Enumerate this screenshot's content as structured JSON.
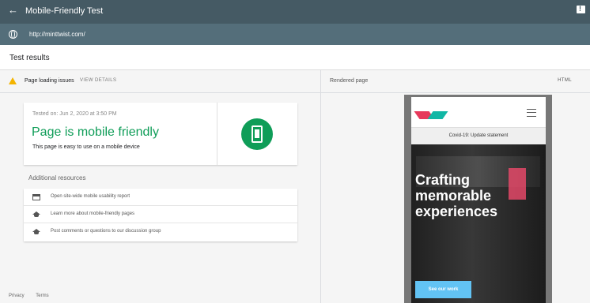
{
  "app": {
    "title": "Mobile-Friendly Test",
    "url": "http://minttwist.com/"
  },
  "results": {
    "title": "Test results",
    "issues_label": "Page loading issues",
    "details_label": "VIEW DETAILS",
    "tested_on": "Tested on: Jun 2, 2020 at 3:50 PM",
    "headline": "Page is mobile friendly",
    "description": "This page is easy to use on a mobile device"
  },
  "additional_resources": {
    "title": "Additional resources",
    "items": [
      {
        "label": "Open site-wide mobile usability report",
        "icon": "report-icon"
      },
      {
        "label": "Learn more about mobile-friendly pages",
        "icon": "school-icon"
      },
      {
        "label": "Post comments or questions to our discussion group",
        "icon": "school-icon"
      }
    ]
  },
  "footer": {
    "privacy": "Privacy",
    "terms": "Terms"
  },
  "rendered_page": {
    "title": "Rendered page",
    "html_label": "HTML",
    "covid": "Covid-19: Update statement",
    "hero_lines": [
      "Crafting",
      "memorable",
      "experiences"
    ],
    "cta": "See our work"
  },
  "colors": {
    "topbar": "#455a64",
    "urlbar": "#546e7a",
    "success": "#0f9d58",
    "warning": "#f4b400",
    "cta": "#62c3f4"
  }
}
